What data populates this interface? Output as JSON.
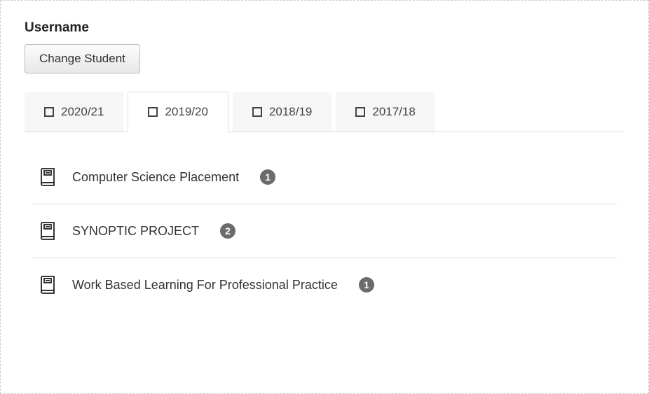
{
  "username_label": "Username",
  "change_student_label": "Change Student",
  "tabs": [
    {
      "label": "2020/21",
      "active": false
    },
    {
      "label": "2019/20",
      "active": true
    },
    {
      "label": "2018/19",
      "active": false
    },
    {
      "label": "2017/18",
      "active": false
    }
  ],
  "courses": [
    {
      "title": "Computer Science Placement",
      "count": "1"
    },
    {
      "title": "SYNOPTIC PROJECT",
      "count": "2"
    },
    {
      "title": "Work Based Learning For Professional Practice",
      "count": "1"
    }
  ]
}
